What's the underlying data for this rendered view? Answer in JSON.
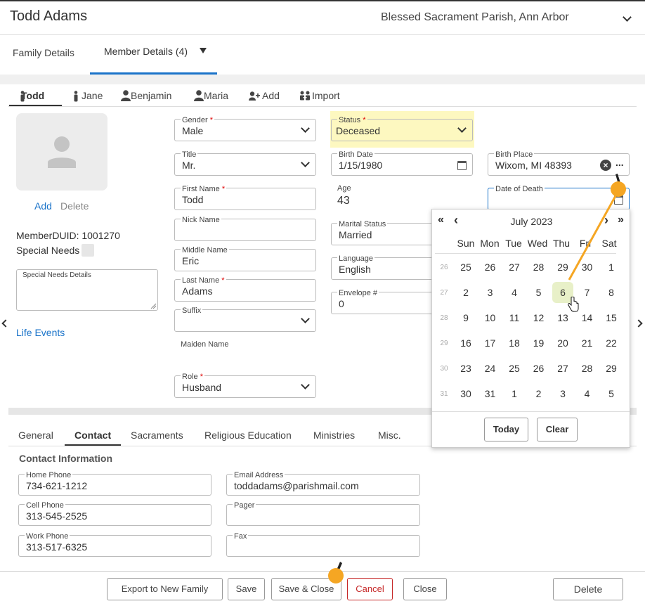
{
  "header": {
    "title": "Todd Adams",
    "parish": "Blessed Sacrament Parish, Ann Arbor"
  },
  "main_tabs": [
    "Family Details",
    "Member Details (4)"
  ],
  "member_tabs": [
    "Todd",
    "Jane",
    "Benjamin",
    "Maria",
    "Add",
    "Import"
  ],
  "photo": {
    "add_label": "Add",
    "delete_label": "Delete"
  },
  "member_info": {
    "duid_label": "MemberDUID:",
    "duid": "1001270",
    "special_needs_label": "Special Needs",
    "special_needs_details_label": "Special Needs Details",
    "life_events_label": "Life Events"
  },
  "fields": {
    "gender": {
      "label": "Gender",
      "value": "Male"
    },
    "title": {
      "label": "Title",
      "value": "Mr."
    },
    "first_name": {
      "label": "First Name",
      "value": "Todd"
    },
    "nick_name": {
      "label": "Nick Name",
      "value": ""
    },
    "middle_name": {
      "label": "Middle Name",
      "value": "Eric"
    },
    "last_name": {
      "label": "Last Name",
      "value": "Adams"
    },
    "suffix": {
      "label": "Suffix",
      "value": ""
    },
    "maiden_name": {
      "label": "Maiden Name",
      "value": ""
    },
    "role": {
      "label": "Role",
      "value": "Husband"
    },
    "status": {
      "label": "Status",
      "value": "Deceased"
    },
    "birth_date": {
      "label": "Birth Date",
      "value": "1/15/1980"
    },
    "age": {
      "label": "Age",
      "value": "43"
    },
    "marital_status": {
      "label": "Marital Status",
      "value": "Married"
    },
    "language": {
      "label": "Language",
      "value": "English"
    },
    "envelope": {
      "label": "Envelope #",
      "value": "0"
    },
    "birth_place": {
      "label": "Birth Place",
      "value": "Wixom, MI 48393",
      "more": "..."
    },
    "date_of_death": {
      "label": "Date of Death",
      "value": ""
    }
  },
  "required_mark": "*",
  "calendar": {
    "month_label": "July 2023",
    "nav_prev_year": "«",
    "nav_prev": "‹",
    "nav_next": "›",
    "nav_next_year": "»",
    "days_of_week": [
      "Sun",
      "Mon",
      "Tue",
      "Wed",
      "Thu",
      "Fri",
      "Sat"
    ],
    "weeks": [
      {
        "num": "26",
        "days": [
          "25",
          "26",
          "27",
          "28",
          "29",
          "30",
          "1"
        ]
      },
      {
        "num": "27",
        "days": [
          "2",
          "3",
          "4",
          "5",
          "6",
          "7",
          "8"
        ]
      },
      {
        "num": "28",
        "days": [
          "9",
          "10",
          "11",
          "12",
          "13",
          "14",
          "15"
        ]
      },
      {
        "num": "29",
        "days": [
          "16",
          "17",
          "18",
          "19",
          "20",
          "21",
          "22"
        ]
      },
      {
        "num": "30",
        "days": [
          "23",
          "24",
          "25",
          "26",
          "27",
          "28",
          "29"
        ]
      },
      {
        "num": "31",
        "days": [
          "30",
          "31",
          "1",
          "2",
          "3",
          "4",
          "5"
        ]
      }
    ],
    "highlighted_day": "6",
    "today_label": "Today",
    "clear_label": "Clear"
  },
  "sub_tabs": [
    "General",
    "Contact",
    "Sacraments",
    "Religious Education",
    "Ministries",
    "Misc."
  ],
  "contact": {
    "heading": "Contact Information",
    "home_phone": {
      "label": "Home Phone",
      "value": "734-621-1212"
    },
    "cell_phone": {
      "label": "Cell Phone",
      "value": "313-545-2525"
    },
    "work_phone": {
      "label": "Work Phone",
      "value": "313-517-6325"
    },
    "email": {
      "label": "Email Address",
      "value": "toddadams@parishmail.com"
    },
    "pager": {
      "label": "Pager",
      "value": ""
    },
    "fax": {
      "label": "Fax",
      "value": ""
    }
  },
  "footer": {
    "export_label": "Export to New Family",
    "save_label": "Save",
    "save_close_label": "Save & Close",
    "cancel_label": "Cancel",
    "close_label": "Close",
    "delete_label": "Delete"
  },
  "colors": {
    "accent": "#1a73c9",
    "status_highlight": "#fdf8c0",
    "cancel_red": "#c62828",
    "marker": "#f5a623",
    "day_highlight": "#e8f0c8"
  }
}
